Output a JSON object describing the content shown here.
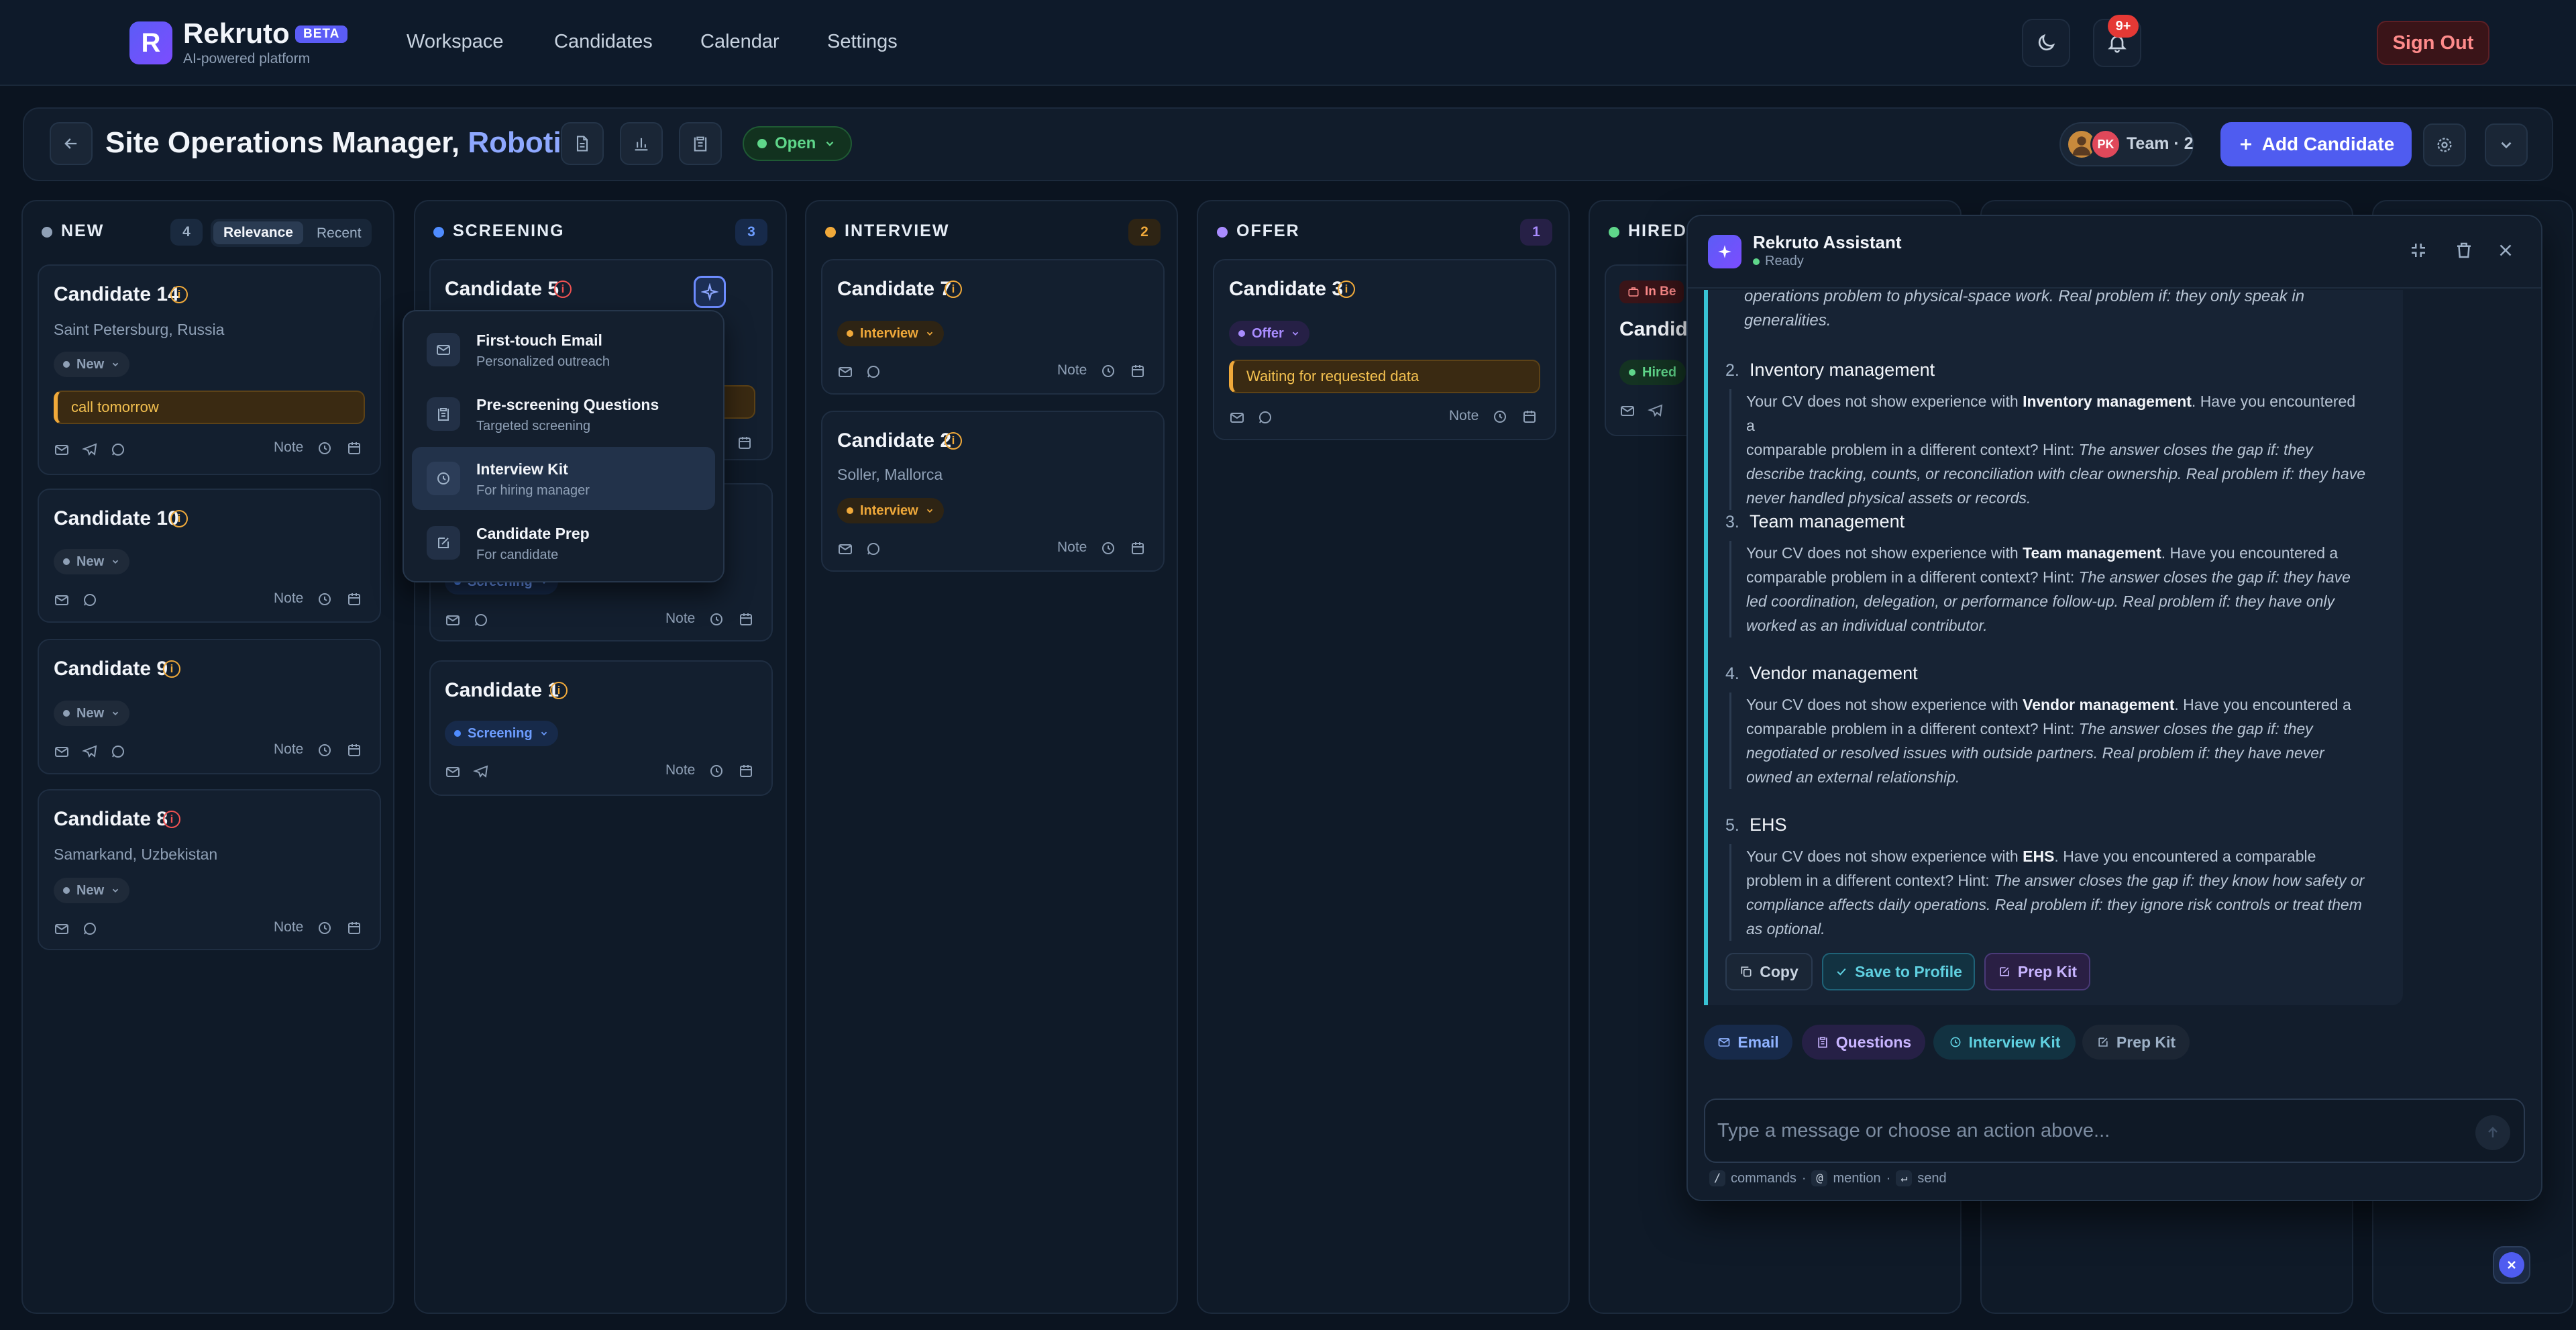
{
  "app": {
    "name": "Rekruto",
    "badge": "BETA",
    "tagline": "AI-powered platform",
    "nav": [
      "Workspace",
      "Candidates",
      "Calendar",
      "Settings"
    ],
    "notifications": "9+",
    "sign_out": "Sign Out"
  },
  "job": {
    "title_main": "Site Operations Manager,",
    "title_accent": "Robotics",
    "status": "Open",
    "team": "Team · 2",
    "team_initials": "PK",
    "add_candidate": "Add Candidate"
  },
  "columns": {
    "new": {
      "title": "NEW",
      "count": "4",
      "color": "#8fa0b6",
      "sort": {
        "active": "Relevance",
        "other": "Recent"
      }
    },
    "screening": {
      "title": "SCREENING",
      "count": "3",
      "color": "#4f8cff"
    },
    "interview": {
      "title": "INTERVIEW",
      "count": "2",
      "color": "#f0a93a"
    },
    "offer": {
      "title": "OFFER",
      "count": "1",
      "color": "#a98cff"
    },
    "hired": {
      "title": "HIRED",
      "color": "#5fd68a"
    }
  },
  "cards": {
    "c14": {
      "name": "Candidate 14",
      "location": "Saint Petersburg, Russia",
      "stage": "New",
      "note": "call tomorrow",
      "note_label": "Note"
    },
    "c10": {
      "name": "Candidate 10",
      "stage": "New",
      "note_label": "Note"
    },
    "c9": {
      "name": "Candidate 9",
      "stage": "New",
      "note_label": "Note"
    },
    "c8": {
      "name": "Candidate 8",
      "location": "Samarkand, Uzbekistan",
      "stage": "New",
      "note_label": "Note"
    },
    "c5": {
      "name": "Candidate 5",
      "note_label": "Note"
    },
    "c_hidden": {
      "stage": "Screening",
      "note_label": "Note"
    },
    "c1": {
      "name": "Candidate 1",
      "stage": "Screening",
      "note_label": "Note"
    },
    "c7": {
      "name": "Candidate 7",
      "stage": "Interview",
      "note_label": "Note"
    },
    "c2": {
      "name": "Candidate 2",
      "location": "Soller, Mallorca",
      "stage": "Interview",
      "note_label": "Note"
    },
    "c3": {
      "name": "Candidate 3",
      "stage": "Offer",
      "note": "Waiting for requested data",
      "note_label": "Note"
    },
    "hired_card": {
      "name_partial": "Candida",
      "tag_partial": "In Be",
      "stage": "Hired"
    }
  },
  "menu": [
    {
      "title": "First-touch Email",
      "sub": "Personalized outreach"
    },
    {
      "title": "Pre-screening Questions",
      "sub": "Targeted screening"
    },
    {
      "title": "Interview Kit",
      "sub": "For hiring manager"
    },
    {
      "title": "Candidate Prep",
      "sub": "For candidate"
    }
  ],
  "assistant": {
    "title": "Rekruto Assistant",
    "status": "Ready",
    "intro_lines": [
      "operations problem to physical-space work. Real problem if: they only speak in",
      "generalities."
    ],
    "questions": [
      {
        "num": "2.",
        "title": "Inventory management",
        "l1": "Your CV does not show experience with ",
        "b1": "Inventory management",
        "l1b": ". Have you encountered a",
        "l2a": "comparable problem in a different context? Hint: ",
        "l2b": "The answer closes the gap if: they",
        "l3": "describe tracking, counts, or reconciliation with clear ownership. Real problem if: they have",
        "l4": "never handled physical assets or records."
      },
      {
        "num": "3.",
        "title": "Team management",
        "l1": "Your CV does not show experience with ",
        "b1": "Team management",
        "l1b": ". Have you encountered a",
        "l2a": "comparable problem in a different context? Hint: ",
        "l2b": "The answer closes the gap if: they have",
        "l3": "led coordination, delegation, or performance follow-up. Real problem if: they have only",
        "l4": "worked as an individual contributor."
      },
      {
        "num": "4.",
        "title": "Vendor management",
        "l1": "Your CV does not show experience with ",
        "b1": "Vendor management",
        "l1b": ". Have you encountered a",
        "l2a": "comparable problem in a different context? Hint: ",
        "l2b": "The answer closes the gap if: they",
        "l3": "negotiated or resolved issues with outside partners. Real problem if: they have never",
        "l4": "owned an external relationship."
      },
      {
        "num": "5.",
        "title": "EHS",
        "l1": "Your CV does not show experience with ",
        "b1": "EHS",
        "l1b": ". Have you encountered a comparable",
        "l2a": "problem in a different context? Hint: ",
        "l2b": "The answer closes the gap if: they know how safety or",
        "l3": "compliance affects daily operations. Real problem if: they ignore risk controls or treat them",
        "l4": "as optional."
      }
    ],
    "actions": {
      "copy": "Copy",
      "save": "Save to Profile",
      "prep": "Prep Kit"
    },
    "chips": {
      "email": "Email",
      "questions": "Questions",
      "interview_kit": "Interview Kit",
      "prep_kit": "Prep Kit"
    },
    "composer_placeholder": "Type a message or choose an action above...",
    "hints": {
      "commands": "commands",
      "mention": "mention",
      "send": "send",
      "dot": "·"
    }
  }
}
